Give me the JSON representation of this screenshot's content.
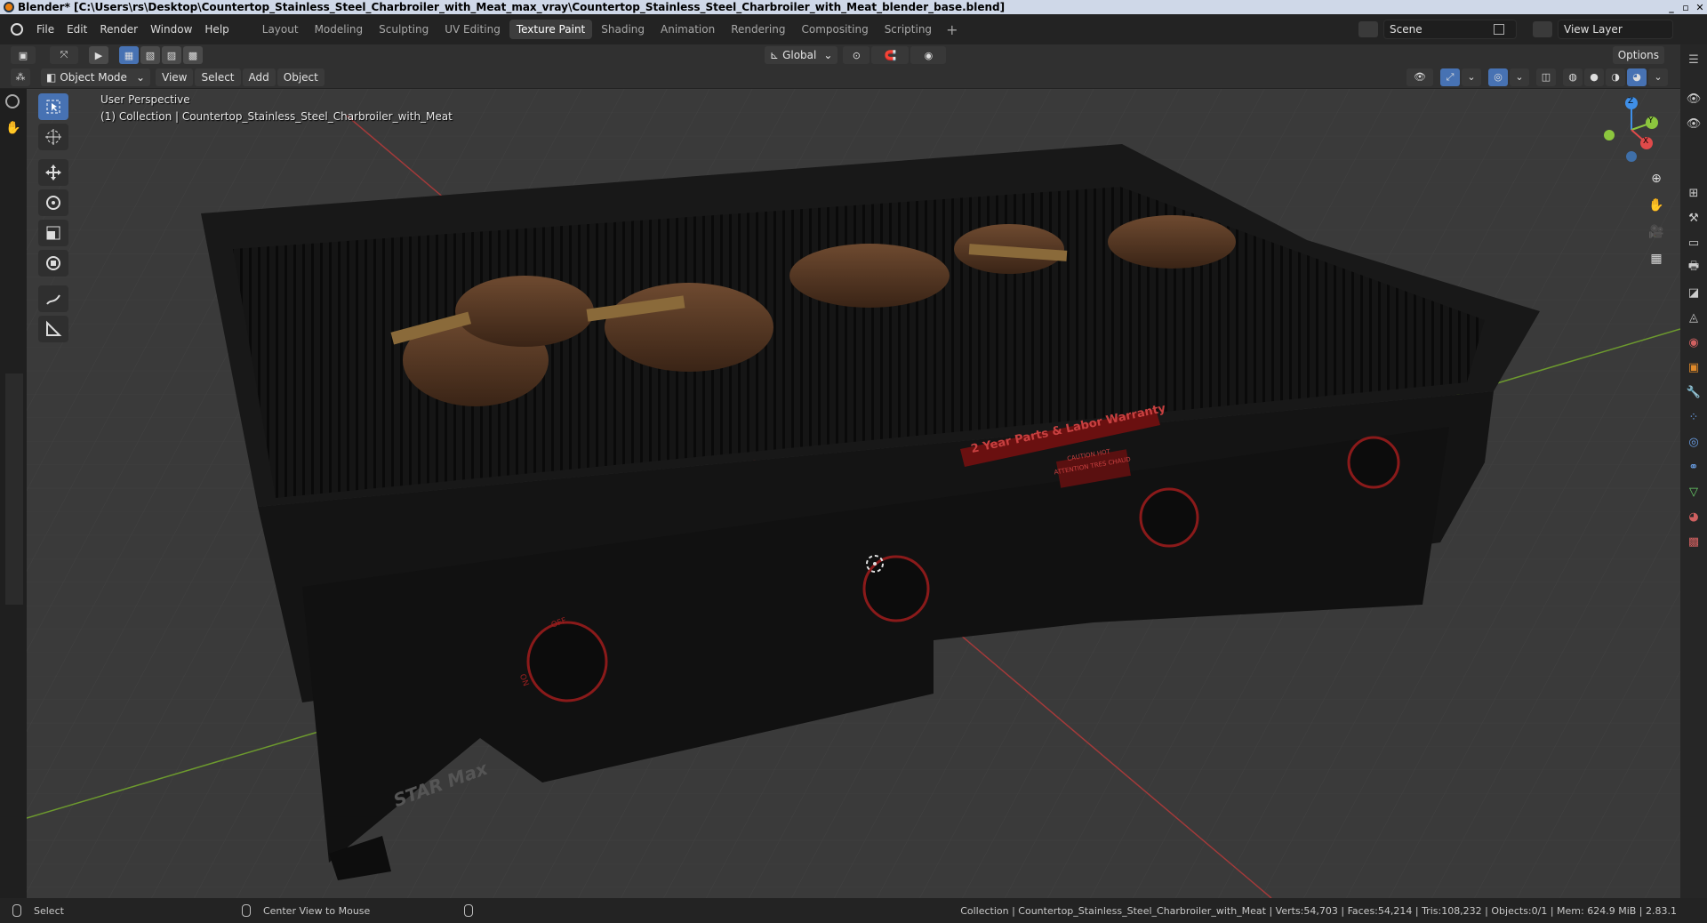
{
  "window": {
    "title": "Blender* [C:\\Users\\rs\\Desktop\\Countertop_Stainless_Steel_Charbroiler_with_Meat_max_vray\\Countertop_Stainless_Steel_Charbroiler_with_Meat_blender_base.blend]",
    "controls": [
      "_",
      "▫",
      "✕"
    ]
  },
  "menu": {
    "items": [
      "File",
      "Edit",
      "Render",
      "Window",
      "Help"
    ]
  },
  "workspaces": {
    "tabs": [
      "Layout",
      "Modeling",
      "Sculpting",
      "UV Editing",
      "Texture Paint",
      "Shading",
      "Animation",
      "Rendering",
      "Compositing",
      "Scripting"
    ],
    "active": "Texture Paint",
    "add": "+"
  },
  "scene": {
    "name": "Scene",
    "view_layer": "View Layer"
  },
  "header": {
    "transform_orientation": "Global",
    "options": "Options",
    "mode": "Object Mode",
    "view_menu": [
      "View",
      "Select",
      "Add",
      "Object"
    ]
  },
  "viewport": {
    "perspective": "User Perspective",
    "collection": "(1) Collection | Countertop_Stainless_Steel_Charbroiler_with_Meat",
    "label_warranty": "2 Year Parts & Labor Warranty",
    "label_caution": "CAUTION HOT",
    "label_caution2": "ATTENTION TRES CHAUD",
    "brand": "STAR Max",
    "knob_off": "OFF",
    "knob_on": "ON",
    "gizmo": {
      "x": "X",
      "y": "Y",
      "z": "Z"
    }
  },
  "status": {
    "select": "Select",
    "center_view": "Center View to Mouse",
    "info": "Collection | Countertop_Stainless_Steel_Charbroiler_with_Meat | Verts:54,703 | Faces:54,214 | Tris:108,232 | Objects:0/1 | Mem: 624.9 MiB | 2.83.1"
  },
  "colors": {
    "accent": "#4772b3",
    "x_axis": "#e04a4a",
    "y_axis": "#8cc63e",
    "z_axis": "#3f8fe8",
    "grid_bg": "#3a3a3a"
  }
}
